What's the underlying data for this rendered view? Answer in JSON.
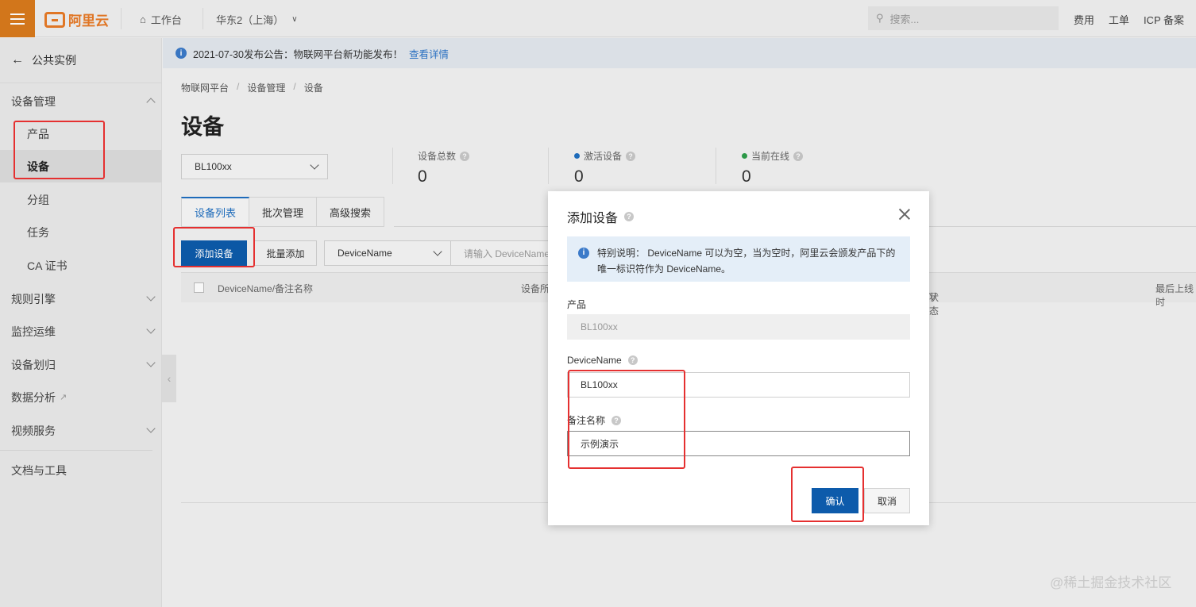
{
  "topbar": {
    "brand": "阿里云",
    "workbench": "工作台",
    "region": "华东2（上海）",
    "search_placeholder": "搜索...",
    "links": [
      "费用",
      "工单",
      "ICP 备案"
    ]
  },
  "sidebar": {
    "back_label": "公共实例",
    "items": [
      {
        "label": "设备管理"
      },
      {
        "label": "产品"
      },
      {
        "label": "设备"
      },
      {
        "label": "分组"
      },
      {
        "label": "任务"
      },
      {
        "label": "CA 证书"
      },
      {
        "label": "规则引擎"
      },
      {
        "label": "监控运维"
      },
      {
        "label": "设备划归"
      },
      {
        "label": "数据分析"
      },
      {
        "label": "视频服务"
      },
      {
        "label": "文档与工具"
      }
    ]
  },
  "notice": {
    "text": "2021-07-30发布公告：物联网平台新功能发布！",
    "link": "查看详情"
  },
  "breadcrumb": [
    "物联网平台",
    "设备管理",
    "设备"
  ],
  "page_title": "设备",
  "product_select": "BL100xx",
  "stats": [
    {
      "label": "设备总数",
      "value": "0"
    },
    {
      "label": "激活设备",
      "value": "0",
      "color": "#1f6fc1"
    },
    {
      "label": "当前在线",
      "value": "0",
      "color": "#2e9d4a"
    }
  ],
  "tabs": [
    "设备列表",
    "批次管理",
    "高级搜索"
  ],
  "toolbar": {
    "add_device": "添加设备",
    "batch_add": "批量添加",
    "filter_field": "DeviceName",
    "filter_placeholder": "请输入 DeviceName"
  },
  "table": {
    "columns": [
      "DeviceName/备注名称",
      "设备所",
      "状态",
      "最后上线时"
    ]
  },
  "modal": {
    "title": "添加设备",
    "tip": "特别说明： DeviceName 可以为空，当为空时，阿里云会颁发产品下的唯一标识符作为 DeviceName。",
    "product_label": "产品",
    "product_value": "BL100xx",
    "devicename_label": "DeviceName",
    "devicename_value": "BL100xx",
    "remark_label": "备注名称",
    "remark_value": "示例演示",
    "confirm": "确认",
    "cancel": "取消"
  },
  "watermark": "@稀土掘金技术社区",
  "colors": {
    "accent": "#0d5bab",
    "brand": "#e87a27",
    "annotation": "#e53030"
  }
}
